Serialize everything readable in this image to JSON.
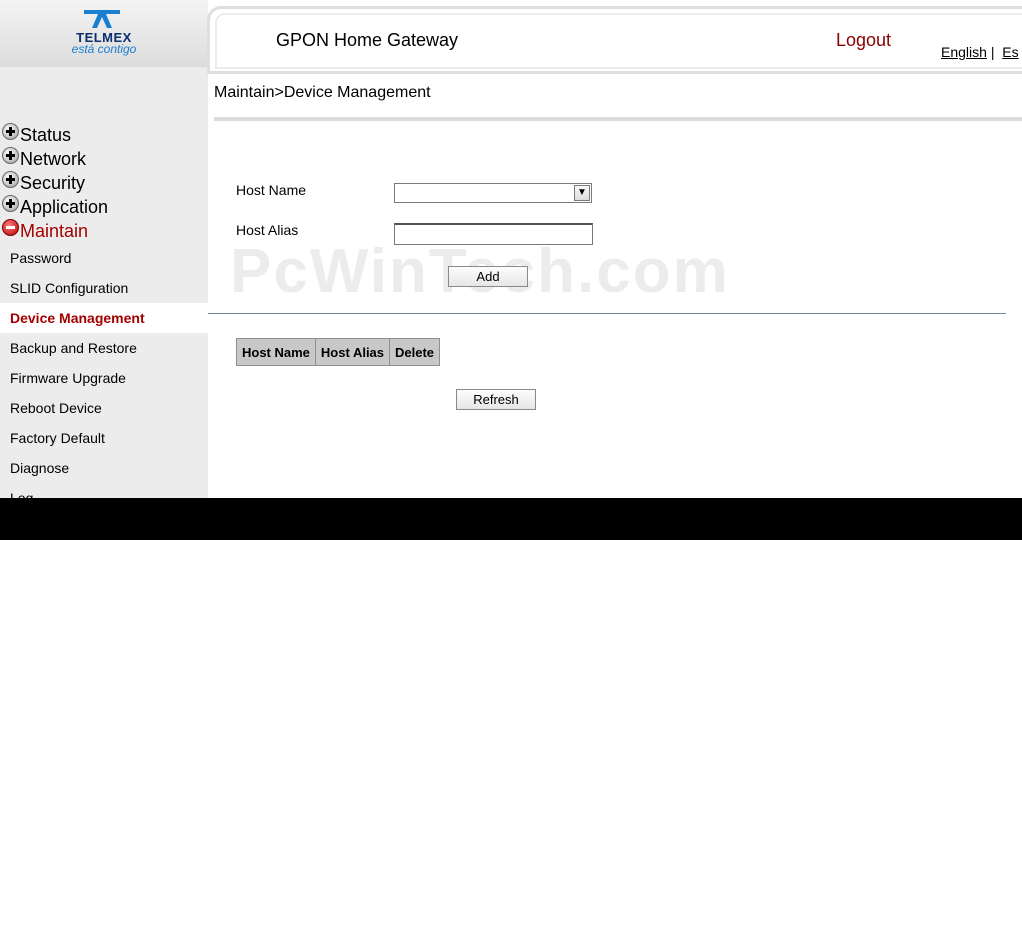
{
  "brand": {
    "name": "TELMEX",
    "tagline": "está contigo",
    "color": "#0b2e6f"
  },
  "header": {
    "title": "GPON Home Gateway",
    "logout": "Logout",
    "lang_english": "English",
    "lang_sep": "|",
    "lang_other": "Es"
  },
  "breadcrumb": "Maintain>Device Management",
  "menu": {
    "items": [
      {
        "label": "Status",
        "icon": "expand-icon"
      },
      {
        "label": "Network",
        "icon": "expand-icon"
      },
      {
        "label": "Security",
        "icon": "expand-icon"
      },
      {
        "label": "Application",
        "icon": "expand-icon"
      },
      {
        "label": "Maintain",
        "icon": "collapse-icon"
      }
    ],
    "sub_items": [
      "Password",
      "SLID Configuration",
      "Device Management",
      "Backup and Restore",
      "Firmware Upgrade",
      "Reboot Device",
      "Factory Default",
      "Diagnose",
      "Log"
    ],
    "selected": "Device Management"
  },
  "form": {
    "host_name_label": "Host Name",
    "host_name_value": "",
    "host_alias_label": "Host Alias",
    "host_alias_value": "",
    "add_label": "Add"
  },
  "table": {
    "columns": [
      "Host Name",
      "Host Alias",
      "Delete"
    ]
  },
  "refresh_label": "Refresh",
  "watermark": "PcWinTech.com",
  "colors": {
    "accent": "#a40000",
    "logout": "#8b0000",
    "sidebar_bg": "#ececec"
  }
}
